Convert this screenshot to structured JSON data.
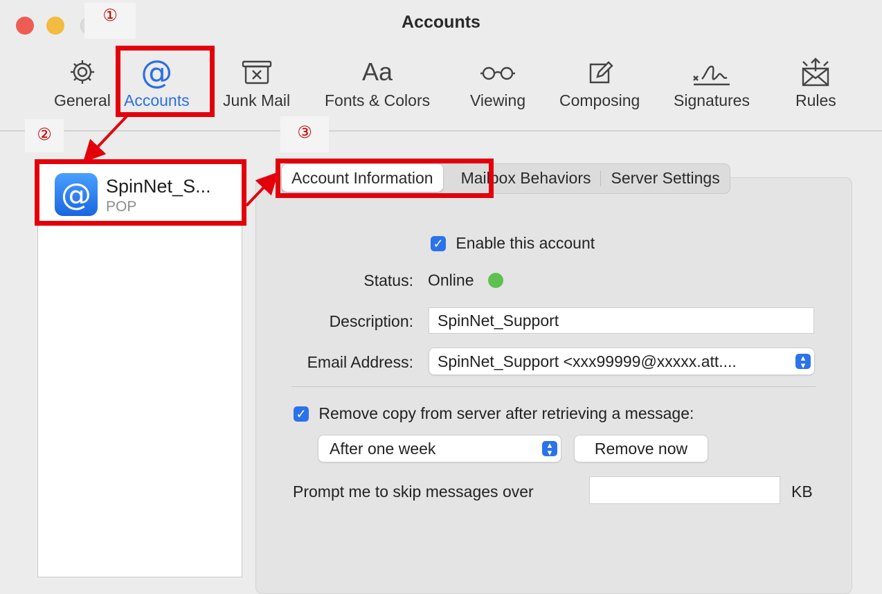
{
  "window": {
    "title": "Accounts"
  },
  "markers": {
    "m1": "①",
    "m2": "②",
    "m3": "③"
  },
  "toolbar": {
    "items": [
      {
        "label": "General",
        "icon": "gear-icon"
      },
      {
        "label": "Accounts",
        "icon": "at-icon"
      },
      {
        "label": "Junk Mail",
        "icon": "junk-mail-icon"
      },
      {
        "label": "Fonts & Colors",
        "icon": "fonts-icon"
      },
      {
        "label": "Viewing",
        "icon": "glasses-icon"
      },
      {
        "label": "Composing",
        "icon": "compose-icon"
      },
      {
        "label": "Signatures",
        "icon": "signature-icon"
      },
      {
        "label": "Rules",
        "icon": "rules-icon"
      }
    ],
    "fonts_glyph": "Aa",
    "junk_glyph": "✕",
    "at_glyph": "@"
  },
  "sidebar": {
    "account": {
      "name": "SpinNet_S...",
      "type": "POP",
      "icon_glyph": "@"
    }
  },
  "tabs": [
    {
      "label": "Account Information"
    },
    {
      "label": "Mailbox Behaviors"
    },
    {
      "label": "Server Settings"
    }
  ],
  "form": {
    "enable_label": "Enable this account",
    "status_label": "Status:",
    "status_value": "Online",
    "description_label": "Description:",
    "description_value": "SpinNet_Support",
    "email_label": "Email Address:",
    "email_value": "SpinNet_Support <xxx99999@xxxxx.att....",
    "remove_copy_label": "Remove copy from server after retrieving a message:",
    "remove_period": "After one week",
    "remove_now": "Remove now",
    "prompt_label": "Prompt me to skip messages over",
    "prompt_value": "",
    "kb_label": "KB",
    "check_glyph": "✓"
  },
  "colors": {
    "accent": "#2b73ea",
    "highlight": "#e3000b",
    "online": "#5cc14f"
  }
}
